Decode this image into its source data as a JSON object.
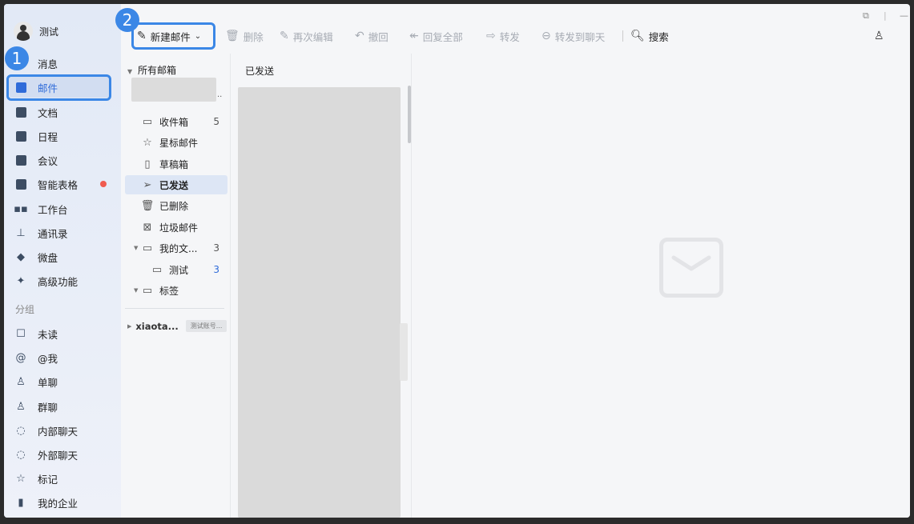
{
  "background": {
    "title": ""
  },
  "nav": {
    "user_name": "测试",
    "items": [
      {
        "label": "消息",
        "icon": "message-icon"
      },
      {
        "label": "邮件",
        "icon": "mail-icon",
        "active": true
      },
      {
        "label": "文档",
        "icon": "doc-icon"
      },
      {
        "label": "日程",
        "icon": "calendar-icon"
      },
      {
        "label": "会议",
        "icon": "meeting-icon"
      },
      {
        "label": "智能表格",
        "icon": "smart-sheet-icon",
        "badge": "red-dot"
      },
      {
        "label": "工作台",
        "icon": "workbench-icon"
      },
      {
        "label": "通讯录",
        "icon": "contacts-icon"
      },
      {
        "label": "微盘",
        "icon": "drive-icon"
      },
      {
        "label": "高级功能",
        "icon": "advanced-icon"
      }
    ],
    "group_title": "分组",
    "group_items": [
      {
        "label": "未读",
        "icon": "unread-icon"
      },
      {
        "label": "@我",
        "icon": "at-icon"
      },
      {
        "label": "单聊",
        "icon": "single-chat-icon"
      },
      {
        "label": "群聊",
        "icon": "group-chat-icon"
      },
      {
        "label": "内部聊天",
        "icon": "internal-chat-icon"
      },
      {
        "label": "外部聊天",
        "icon": "external-chat-icon"
      },
      {
        "label": "标记",
        "icon": "star-icon"
      },
      {
        "label": "我的企业",
        "icon": "company-icon"
      }
    ]
  },
  "annotations": {
    "step1": "1",
    "step2": "2"
  },
  "toolbar": {
    "compose": "新建邮件",
    "delete": "删除",
    "re_edit": "再次编辑",
    "undo": "撤回",
    "reply_all": "回复全部",
    "forward": "转发",
    "forward_chat": "转发到聊天",
    "search": "搜索"
  },
  "folders": {
    "all_mailboxes": "所有邮箱",
    "items": [
      {
        "label": "收件箱",
        "count": "5"
      },
      {
        "label": "星标邮件",
        "count": ""
      },
      {
        "label": "草稿箱",
        "count": ""
      },
      {
        "label": "已发送",
        "count": "",
        "active": true
      },
      {
        "label": "已删除",
        "count": ""
      },
      {
        "label": "垃圾邮件",
        "count": ""
      },
      {
        "label": "我的文...",
        "count": "3"
      },
      {
        "label": "测试",
        "count": "3"
      },
      {
        "label": "标签",
        "count": ""
      }
    ],
    "second_account": "xiaota...",
    "second_account_tag": "测试账号..."
  },
  "list": {
    "title": "已发送"
  },
  "colors": {
    "accent": "#2f6bd9",
    "highlight": "#3b87e6",
    "badge": "#f05b4f"
  }
}
